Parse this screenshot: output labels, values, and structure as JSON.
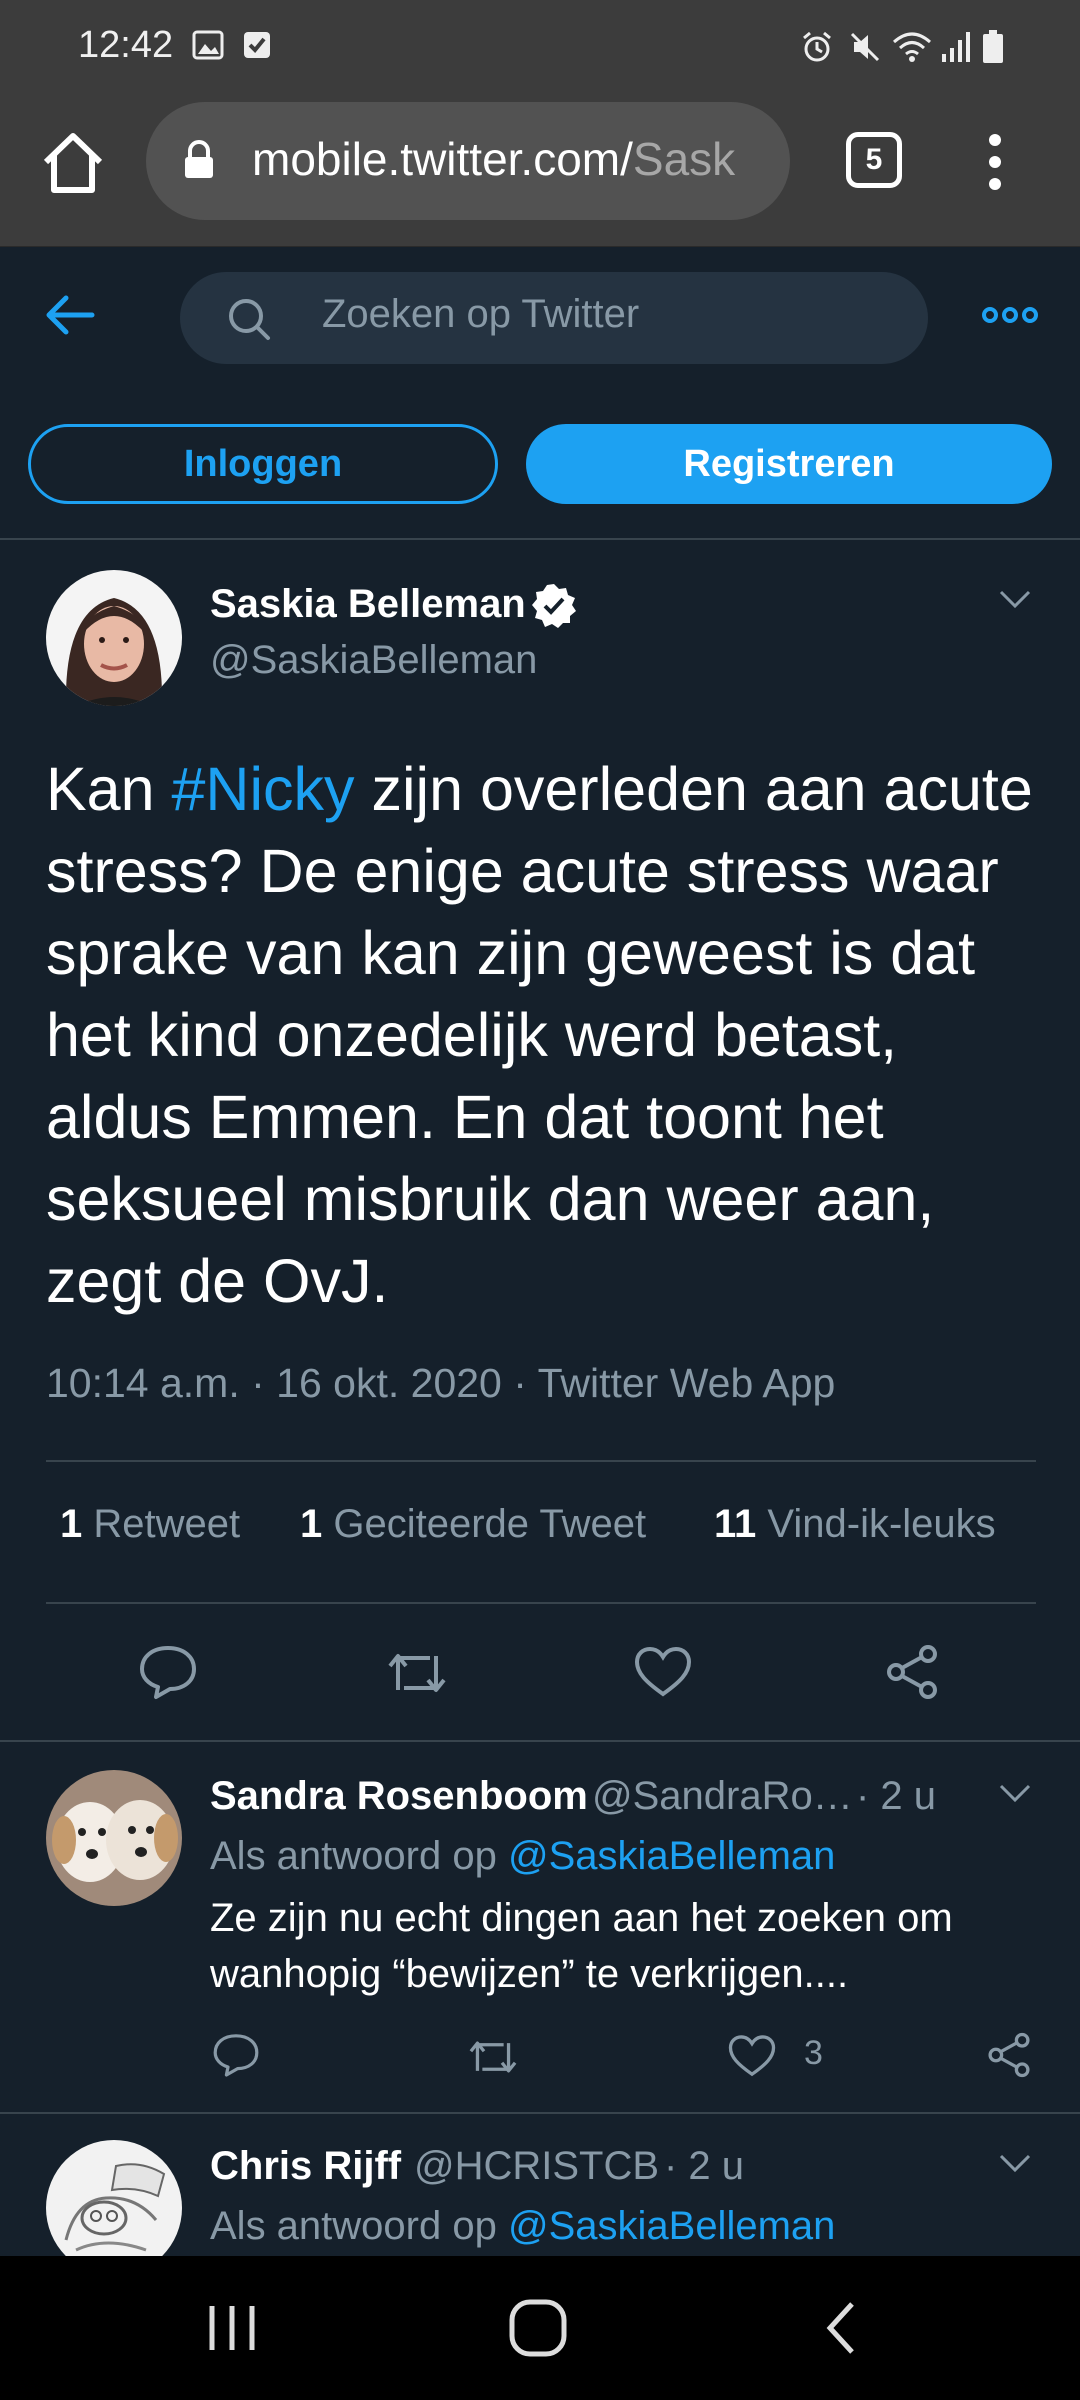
{
  "status_bar": {
    "time": "12:42"
  },
  "browser": {
    "url_host": "mobile.twitter.com/",
    "url_path": "Sask",
    "tab_count": "5"
  },
  "header": {
    "search_placeholder": "Zoeken op Twitter"
  },
  "auth": {
    "login_label": "Inloggen",
    "register_label": "Registreren"
  },
  "main_tweet": {
    "author_name": "Saskia Belleman",
    "author_handle": "@SaskiaBelleman",
    "text_prefix": "Kan ",
    "hashtag": "#Nicky",
    "text_rest": " zijn overleden aan acute stress? De enige acute stress waar sprake van kan zijn geweest is dat het kind onzedelijk werd betast, aldus Emmen. En dat toont het seksueel misbruik dan weer aan, zegt de OvJ.",
    "time": "10:14 a.m.",
    "date": "16 okt. 2020",
    "source": "Twitter Web App",
    "retweets": "1",
    "retweets_label": "Retweet",
    "quotes": "1",
    "quotes_label": "Geciteerde Tweet",
    "likes": "11",
    "likes_label": "Vind-ik-leuks"
  },
  "replies": [
    {
      "name": "Sandra Rosenboom",
      "handle": "@SandraRo…",
      "age": "· 2 u",
      "reply_to_label": "Als antwoord op",
      "reply_to": "@SaskiaBelleman",
      "text": "Ze zijn nu echt dingen aan het zoeken om wanhopig “bewijzen” te verkrijgen....",
      "likes": "3"
    },
    {
      "name": "Chris Rijff",
      "handle": "@HCRISTCB",
      "age": "· 2 u",
      "reply_to_label": "Als antwoord op",
      "reply_to": "@SaskiaBelleman"
    }
  ],
  "colors": {
    "background": "#15202b",
    "accent": "#1da1f2",
    "muted": "#8899a6"
  }
}
